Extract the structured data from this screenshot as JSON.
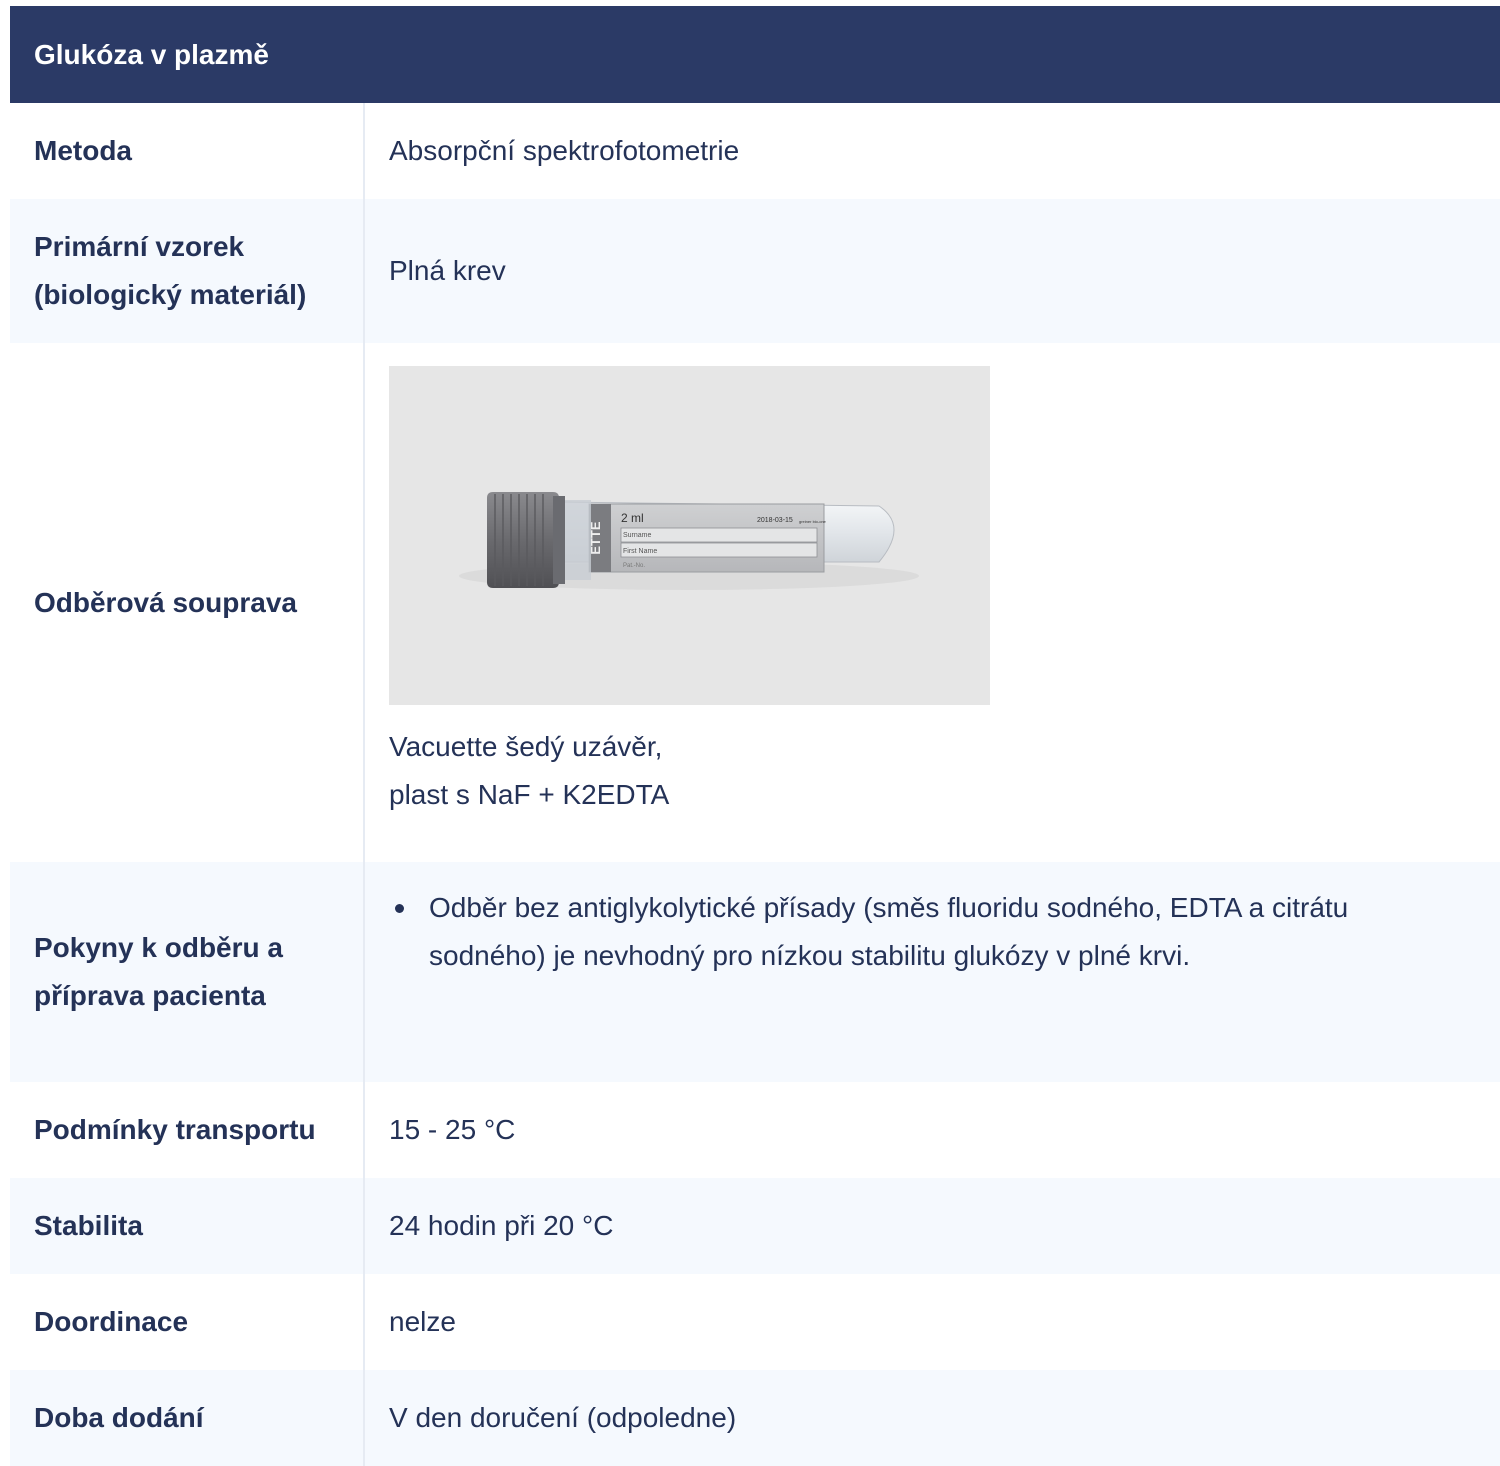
{
  "title": "Glukóza v plazmě",
  "rows": {
    "metoda": {
      "label": "Metoda",
      "value": "Absorpční spektrofotometrie"
    },
    "primarni_vzorek": {
      "label": "Primární vzorek (biologický materiál)",
      "value": "Plná krev"
    },
    "odberova_souprava": {
      "label": "Odběrová souprava",
      "caption_line1": "Vacuette šedý uzávěr,",
      "caption_line2": "plast s NaF + K2EDTA",
      "tube_label": {
        "volume": "2 ml",
        "date": "2018-03-15",
        "brand": "greiner bio-one",
        "field1": "Surname",
        "field2": "First Name",
        "field3": "Pat.-No.",
        "side_text": "ETTE"
      }
    },
    "pokyny": {
      "label": "Pokyny k odběru a příprava pacienta",
      "bullets": [
        "Odběr bez antiglykolytické přísady (směs fluoridu sodného, EDTA a citrátu sodného) je nevhodný pro nízkou stabilitu glukózy v plné krvi."
      ]
    },
    "transport": {
      "label": "Podmínky transportu",
      "value": "15 - 25 °C"
    },
    "stabilita": {
      "label": "Stabilita",
      "value": "24 hodin při 20 °C"
    },
    "doordinace": {
      "label": "Doordinace",
      "value": "nelze"
    },
    "doba_dodani": {
      "label": "Doba dodání",
      "value": "V den doručení (odpoledne)"
    }
  },
  "colors": {
    "header_bg": "#2b3a66",
    "text": "#243257",
    "row_tint": "#f5f9fe",
    "cap_gray": "#6e6e72"
  }
}
